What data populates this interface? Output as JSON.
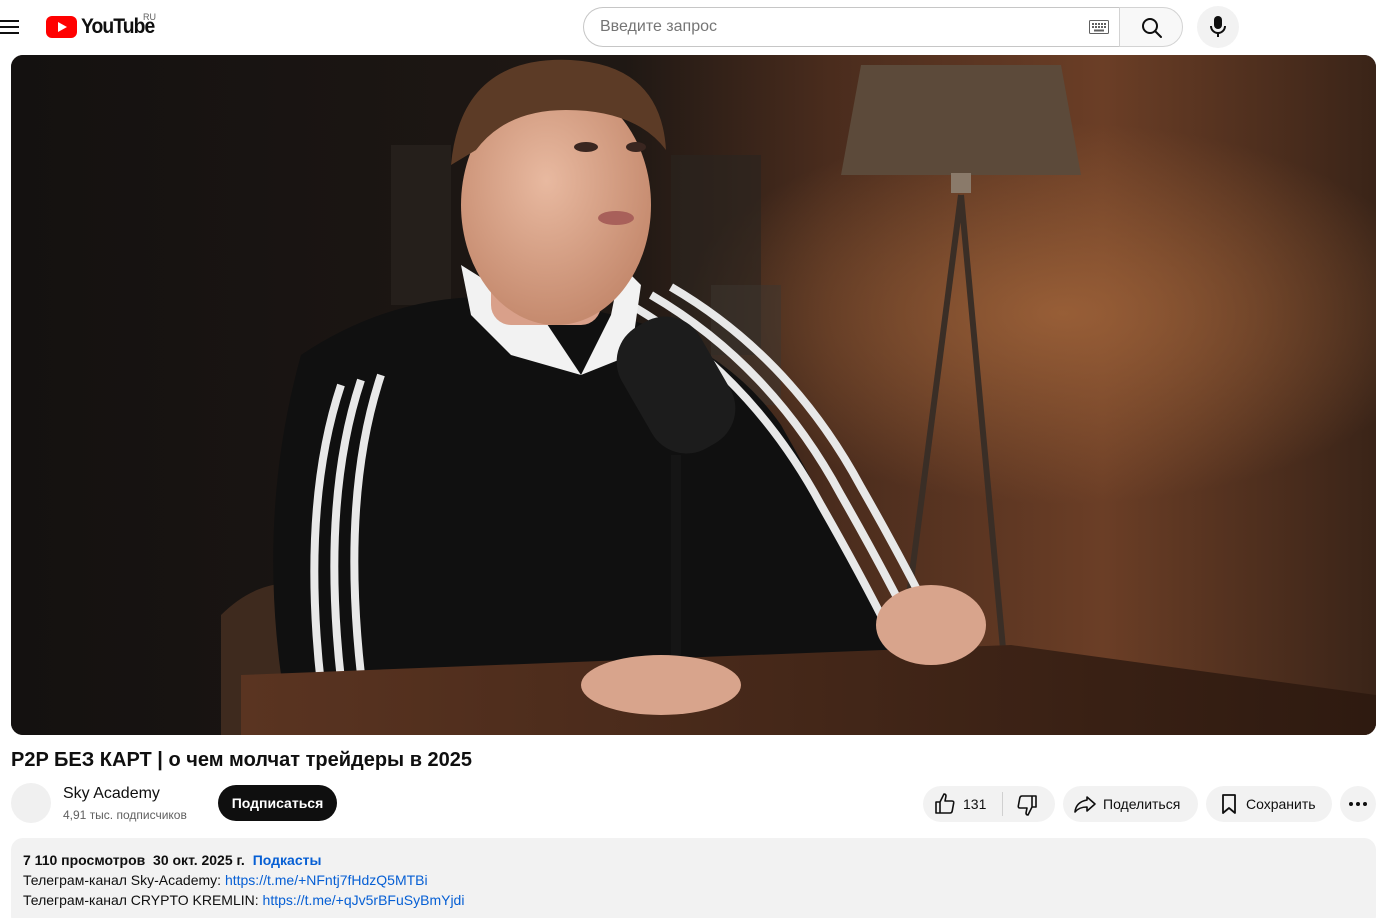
{
  "header": {
    "logo_text": "YouTube",
    "region": "RU",
    "search_placeholder": "Введите запрос",
    "icons": [
      "menu-icon",
      "youtube-logo-icon",
      "keyboard-icon",
      "search-icon",
      "microphone-icon"
    ]
  },
  "video": {
    "title": "P2P БЕЗ КАРТ | о чем молчат трейдеры в 2025"
  },
  "owner": {
    "channel_name": "Sky Academy",
    "subscribers": "4,91 тыс. подписчиков",
    "subscribe_label": "Подписаться"
  },
  "actions": {
    "like_count": "131",
    "share_label": "Поделиться",
    "save_label": "Сохранить",
    "icons": [
      "thumbs-up-icon",
      "thumbs-down-icon",
      "share-icon",
      "bookmark-icon",
      "more-icon"
    ]
  },
  "description": {
    "views": "7 110 просмотров",
    "date": "30 окт. 2025 г.",
    "tag": "Подкасты",
    "line1_label": "Телеграм-канал Sky-Academy: ",
    "line1_link": "https://t.me/+NFntj7fHdzQ5MTBi",
    "line2_label": "Телеграм-канал CRYPTO KREMLIN: ",
    "line2_link": "https://t.me/+qJv5rBFuSyBmYjdi"
  },
  "colors": {
    "brand_red": "#ff0000",
    "link_blue": "#065fd4",
    "chip_bg": "#f2f2f2",
    "subscribe_bg": "#0f0f0f"
  }
}
